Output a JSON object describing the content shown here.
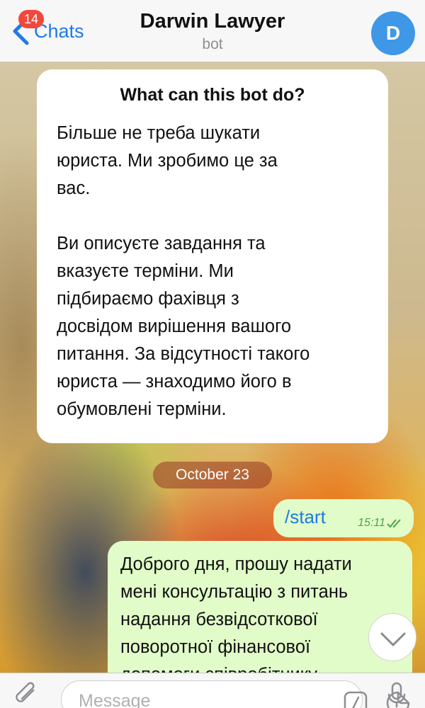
{
  "header": {
    "back_label": "Chats",
    "unread_badge": "14",
    "title": "Darwin Lawyer",
    "subtitle": "bot",
    "avatar_letter": "D"
  },
  "bot_info": {
    "title": "What can this bot do?",
    "text": "Більше не треба шукати\nюриста. Ми зробимо це за\nвас.\n\nВи описуєте завдання та\nвказуєте терміни. Ми\nпідбираємо фахівця з\nдосвідом вирішення вашого\nпитання. За відсутності такого\nюриста — знаходимо його в\nобумовлені терміни."
  },
  "date_divider": "October 23",
  "messages": [
    {
      "text": "/start",
      "time": "15:11",
      "status": "read"
    },
    {
      "text": "Доброго дня, прошу надати\nмені консультацію з питань\nнадання безвідсоткової\nповоротної фінансової\nдопомоги співробітнику"
    }
  ],
  "input": {
    "placeholder": "Message"
  },
  "colors": {
    "accent": "#1f7ae6",
    "badge": "#f4473c",
    "outgoing_bubble": "#e1fcc9",
    "avatar": "#3f97e8"
  }
}
